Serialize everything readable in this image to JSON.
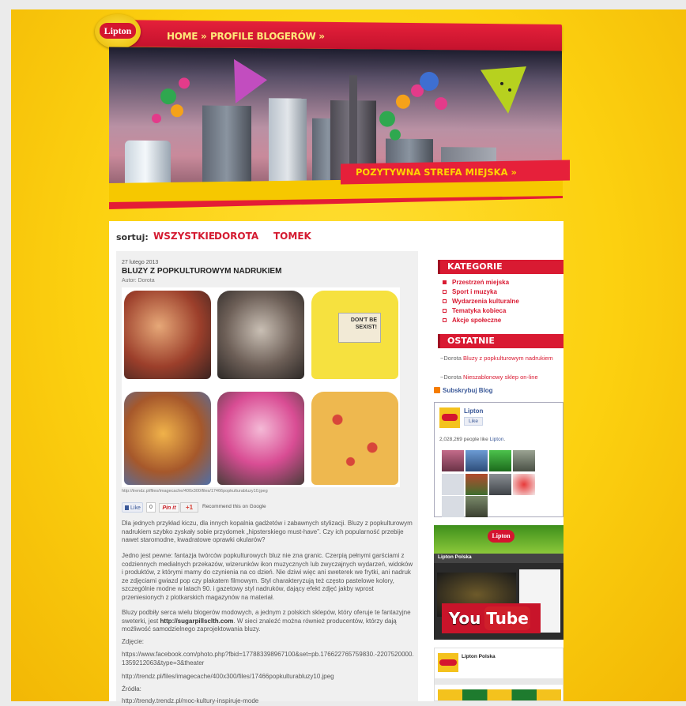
{
  "brand": {
    "logo_text": "Lipton"
  },
  "nav": {
    "home": "HOME »",
    "blogers": "PROFILE BLOGERÓW »"
  },
  "banner": {
    "cta": "POZYTYWNA STREFA MIEJSKA »"
  },
  "sort": {
    "label": "sortuj:",
    "options": [
      "WSZYSTKIE",
      "DOROTA",
      "TOMEK"
    ]
  },
  "article": {
    "date": "27 lutego 2013",
    "title": "BLUZY Z POPKULTUROWYM NADRUKIEM",
    "author": "Autor: Dorota",
    "caption": "http://trendz.pl/files/imagecache/400x300/files/17466popkulturabluzy10.jpeg",
    "shirt_text": "DON'T BE SEXIST!",
    "share": {
      "like": "Like",
      "count": "0",
      "pin": "Pin it",
      "gplus": "+1",
      "recommend": "Recommend this on Google"
    },
    "p1": "Dla jednych przykład kiczu, dla innych kopalnia gadżetów i zabawnych stylizacji. Bluzy z popkulturowym nadrukiem szybko zyskały sobie przydomek „hipsterskiego must-have”. Czy ich popularność przebije nawet staromodne, kwadratowe oprawki okularów?",
    "p2": "Jedno jest pewne: fantazja twórców popkulturowych bluz nie zna granic. Czerpią pełnymi garściami z codziennych medialnych przekazów, wizerunków ikon muzycznych lub zwyczajnych wydarzeń, widoków i produktów, z którymi mamy do czynienia na co dzień. Nie dziwi więc ani sweterek we frytki, ani nadruk ze zdjęciami gwiazd pop czy plakatem filmowym. Styl charakteryzują też często pastelowe kolory, szczególnie modne w latach 90. i gazetowy styl nadruków, dający efekt zdjęć jakby wprost przeniesionych z plotkarskich magazynów na materiał.",
    "p3_a": "Bluzy podbiły serca wielu blogerów modowych, a jednym z polskich sklepów, który oferuje te fantazyjne sweterki, jest ",
    "p3_link": "http://sugarpillsclth.com",
    "p3_b": ". W sieci znaleźć można również producentów, którzy dają możliwość samodzielnego zaprojektowania bluzy.",
    "photo_label": "Zdjęcie:",
    "photo_src1": "https://www.facebook.com/photo.php?fbid=177883398967100&set=pb.176622765759830.-2207520000.1359212063&type=3&theater",
    "photo_src2": "http://trendz.pl/files/imagecache/400x300/files/17466popkulturabluzy10.jpeg",
    "sources_label": "Źródła:",
    "source1": "http://trendy.trendz.pl/moc-kultury-inspiruje-mode"
  },
  "sidebar": {
    "categories_title": "KATEGORIE",
    "categories": [
      "Przestrzeń miejska",
      "Sport i muzyka",
      "Wydarzenia kulturalne",
      "Tematyka kobieca",
      "Akcje społeczne"
    ],
    "recent_title": "OSTATNIE",
    "recent": [
      {
        "author": "~Dorota ",
        "title": "Bluzy z popkulturowym nadrukiem"
      },
      {
        "author": "~Dorota ",
        "title": "Nieszablonowy sklep on-line"
      }
    ],
    "subscribe": "Subskrybuj Blog",
    "fb": {
      "name": "Lipton",
      "like": "Like",
      "count": "2,028,269 people like ",
      "count_link": "Lipton",
      "count_end": "."
    },
    "yt": {
      "you": "You",
      "tube": "Tube",
      "brand": "Lipton",
      "page_title": "Lipton Polska"
    }
  },
  "colors": {
    "accent_red": "#d91a32",
    "yellow": "#fcd110"
  }
}
